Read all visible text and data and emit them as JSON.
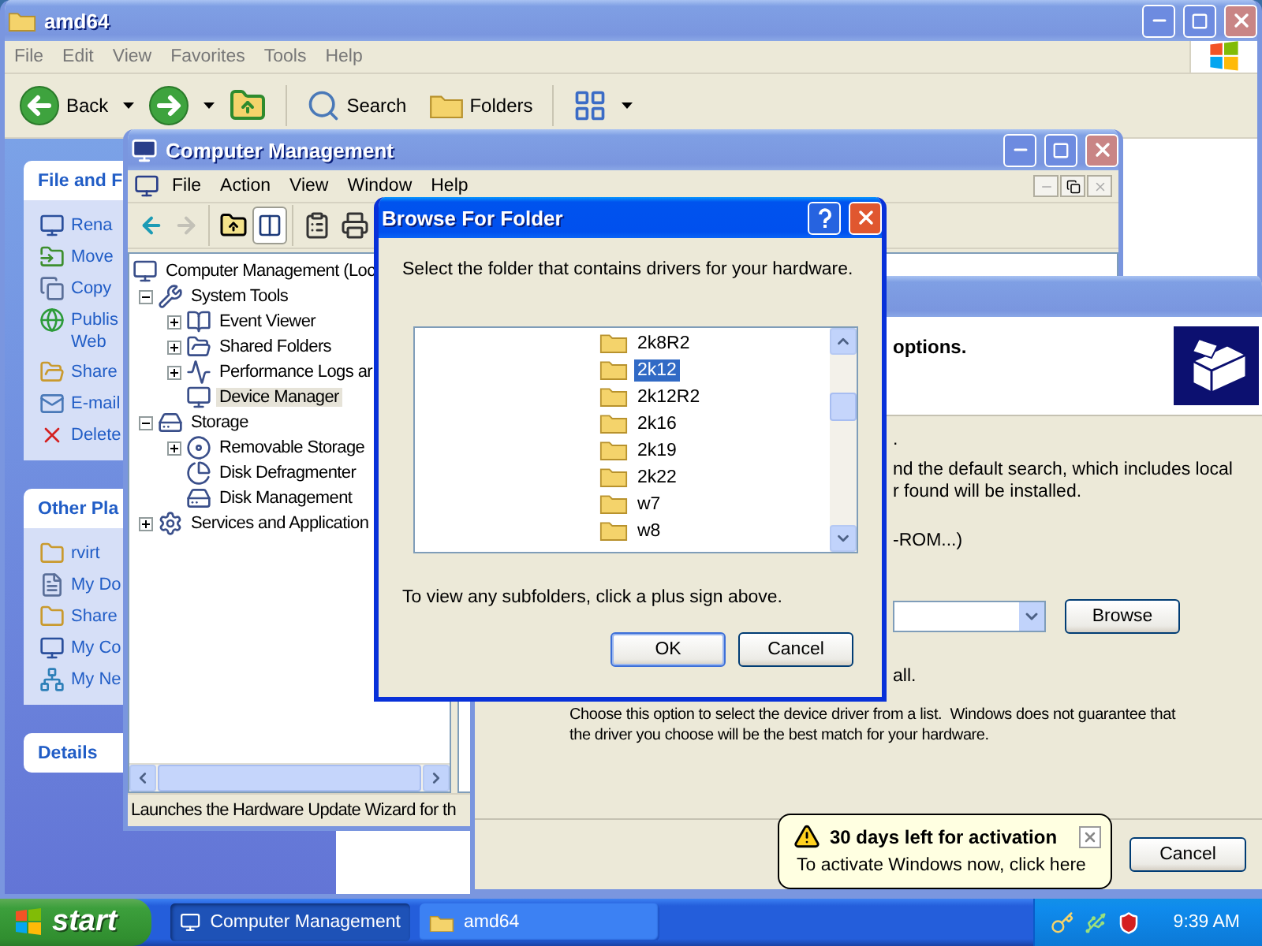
{
  "explorer": {
    "title": "amd64",
    "menu": [
      "File",
      "Edit",
      "View",
      "Favorites",
      "Tools",
      "Help"
    ],
    "toolbar": [
      {
        "kind": "back",
        "label": "Back"
      },
      {
        "kind": "forward"
      },
      {
        "kind": "up"
      },
      {
        "kind": "search",
        "label": "Search"
      },
      {
        "kind": "folders",
        "label": "Folders"
      },
      {
        "kind": "views"
      }
    ],
    "sidebar": [
      {
        "title": "File and F",
        "items": [
          "Rena",
          "Move",
          "Copy",
          "Publis Web",
          "Share",
          "E-mail",
          "Delete"
        ]
      },
      {
        "title": "Other Pla",
        "items": [
          "rvirt",
          "My Do",
          "Share",
          "My Co",
          "My Ne"
        ]
      },
      {
        "title": "Details"
      }
    ]
  },
  "computer_management": {
    "title": "Computer Management",
    "menu": [
      "File",
      "Action",
      "View",
      "Window",
      "Help"
    ],
    "toolbar": [
      {
        "kind": "back",
        "disabled": false,
        "pressed": false
      },
      {
        "kind": "forward",
        "disabled": true,
        "pressed": false
      },
      {
        "kind": "up",
        "disabled": false,
        "pressed": false
      },
      {
        "kind": "tree",
        "disabled": false,
        "pressed": true
      },
      {
        "kind": "properties",
        "disabled": false,
        "pressed": false
      },
      {
        "kind": "print",
        "disabled": false,
        "pressed": false
      }
    ],
    "tree": [
      {
        "label": "Computer Management (Loc",
        "selected": false,
        "children": [
          {
            "label": "System Tools",
            "expanded": true,
            "selected": false,
            "children": [
              {
                "label": "Event Viewer",
                "expanded": false,
                "selected": false
              },
              {
                "label": "Shared Folders",
                "expanded": false,
                "selected": false
              },
              {
                "label": "Performance Logs ar",
                "expanded": false,
                "selected": false
              },
              {
                "label": "Device Manager",
                "selected": true
              }
            ]
          },
          {
            "label": "Storage",
            "expanded": true,
            "selected": false,
            "children": [
              {
                "label": "Removable Storage",
                "expanded": false,
                "selected": false
              },
              {
                "label": "Disk Defragmenter",
                "selected": false
              },
              {
                "label": "Disk Management",
                "selected": false
              }
            ]
          },
          {
            "label": "Services and Application",
            "expanded": false,
            "selected": false
          }
        ]
      }
    ],
    "status": "Launches the Hardware Update Wizard for th"
  },
  "wizard": {
    "header": "options.",
    "lines": [
      ".",
      "nd the default search, which includes local",
      "r found will be installed.",
      "-ROM...)"
    ],
    "browse": "Browse",
    "line_after": "all.",
    "description": [
      "Choose this option to select the device driver from a list.  Windows does not guarantee that",
      "the driver you choose will be the best match for your hardware."
    ],
    "cancel": "Cancel"
  },
  "browse_dialog": {
    "title": "Browse For Folder",
    "prompt": "Select the folder that contains drivers for your hardware.",
    "folders": [
      {
        "name": "2k8R2",
        "selected": false
      },
      {
        "name": "2k12",
        "selected": true
      },
      {
        "name": "2k12R2",
        "selected": false
      },
      {
        "name": "2k16",
        "selected": false
      },
      {
        "name": "2k19",
        "selected": false
      },
      {
        "name": "2k22",
        "selected": false
      },
      {
        "name": "w7",
        "selected": false
      },
      {
        "name": "w8",
        "selected": false
      }
    ],
    "hint": "To view any subfolders, click a plus sign above.",
    "ok": "OK",
    "cancel": "Cancel"
  },
  "balloon": {
    "title": "30 days left for activation",
    "text": "To activate Windows now, click here"
  },
  "taskbar": {
    "start": "start",
    "tasks": [
      {
        "label": "Computer Management",
        "selected": true
      },
      {
        "label": "amd64",
        "selected": false
      }
    ],
    "clock": "9:39 AM"
  }
}
